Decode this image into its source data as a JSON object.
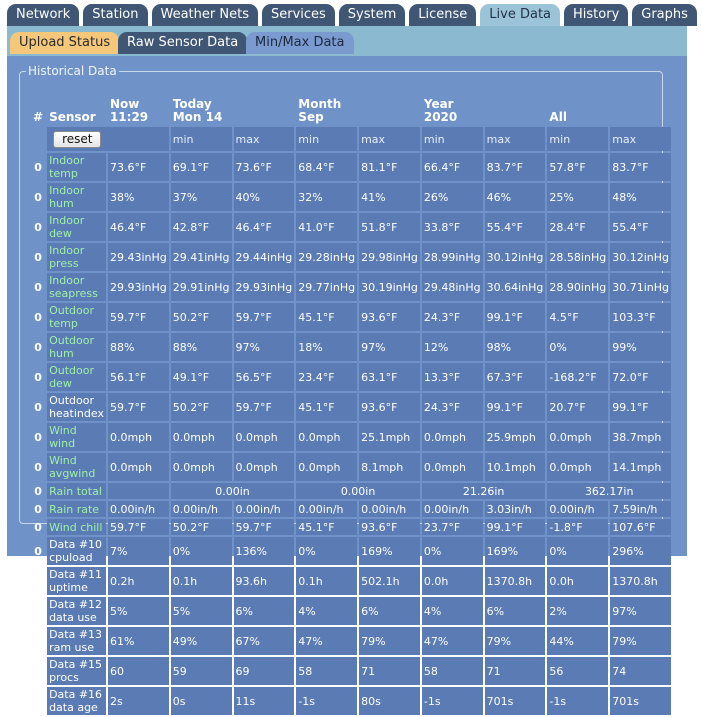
{
  "main_tabs": [
    {
      "label": "Network"
    },
    {
      "label": "Station"
    },
    {
      "label": "Weather Nets"
    },
    {
      "label": "Services"
    },
    {
      "label": "System"
    },
    {
      "label": "License"
    },
    {
      "label": "Live Data",
      "active": true
    },
    {
      "label": "History"
    },
    {
      "label": "Graphs"
    }
  ],
  "sub_tabs": {
    "upload": "Upload Status",
    "raw": "Raw Sensor Data",
    "minmax": "Min/Max Data"
  },
  "legend": "Historical Data",
  "headers": {
    "num": "#",
    "sensor": "Sensor",
    "now_a": "Now",
    "now_b": "11:29",
    "today_a": "Today",
    "today_b": "Mon 14",
    "month_a": "Month",
    "month_b": "Sep",
    "year_a": "Year",
    "year_b": "2020",
    "all": "All"
  },
  "reset_label": "reset",
  "minmax": {
    "min": "min",
    "max": "max"
  },
  "rows": [
    {
      "n": "0",
      "name": "Indoor temp",
      "now": "73.6°F",
      "tmin": "69.1°F",
      "tmax": "73.6°F",
      "mmin": "68.4°F",
      "mmax": "81.1°F",
      "ymin": "66.4°F",
      "ymax": "83.7°F",
      "amin": "57.8°F",
      "amax": "83.7°F"
    },
    {
      "n": "0",
      "name": "Indoor hum",
      "now": "38%",
      "tmin": "37%",
      "tmax": "40%",
      "mmin": "32%",
      "mmax": "41%",
      "ymin": "26%",
      "ymax": "46%",
      "amin": "25%",
      "amax": "48%"
    },
    {
      "n": "0",
      "name": "Indoor dew",
      "now": "46.4°F",
      "tmin": "42.8°F",
      "tmax": "46.4°F",
      "mmin": "41.0°F",
      "mmax": "51.8°F",
      "ymin": "33.8°F",
      "ymax": "55.4°F",
      "amin": "28.4°F",
      "amax": "55.4°F"
    },
    {
      "n": "0",
      "name": "Indoor press",
      "now": "29.43inHg",
      "tmin": "29.41inHg",
      "tmax": "29.44inHg",
      "mmin": "29.28inHg",
      "mmax": "29.98inHg",
      "ymin": "28.99inHg",
      "ymax": "30.12inHg",
      "amin": "28.58inHg",
      "amax": "30.12inHg"
    },
    {
      "n": "0",
      "name": "Indoor seapress",
      "now": "29.93inHg",
      "tmin": "29.91inHg",
      "tmax": "29.93inHg",
      "mmin": "29.77inHg",
      "mmax": "30.19inHg",
      "ymin": "29.48inHg",
      "ymax": "30.64inHg",
      "amin": "28.90inHg",
      "amax": "30.71inHg"
    },
    {
      "n": "0",
      "name": "Outdoor temp",
      "now": "59.7°F",
      "tmin": "50.2°F",
      "tmax": "59.7°F",
      "mmin": "45.1°F",
      "mmax": "93.6°F",
      "ymin": "24.3°F",
      "ymax": "99.1°F",
      "amin": "4.5°F",
      "amax": "103.3°F"
    },
    {
      "n": "0",
      "name": "Outdoor hum",
      "now": "88%",
      "tmin": "88%",
      "tmax": "97%",
      "mmin": "18%",
      "mmax": "97%",
      "ymin": "12%",
      "ymax": "98%",
      "amin": "0%",
      "amax": "99%"
    },
    {
      "n": "0",
      "name": "Outdoor dew",
      "now": "56.1°F",
      "tmin": "49.1°F",
      "tmax": "56.5°F",
      "mmin": "23.4°F",
      "mmax": "63.1°F",
      "ymin": "13.3°F",
      "ymax": "67.3°F",
      "amin": "-168.2°F",
      "amax": "72.0°F"
    },
    {
      "n": "0",
      "name": "Outdoor heatindex",
      "white": true,
      "tall": true,
      "now": "59.7°F",
      "tmin": "50.2°F",
      "tmax": "59.7°F",
      "mmin": "45.1°F",
      "mmax": "93.6°F",
      "ymin": "24.3°F",
      "ymax": "99.1°F",
      "amin": "20.7°F",
      "amax": "99.1°F"
    },
    {
      "n": "0",
      "name": "Wind wind",
      "now": "0.0mph",
      "tmin": "0.0mph",
      "tmax": "0.0mph",
      "mmin": "0.0mph",
      "mmax": "25.1mph",
      "ymin": "0.0mph",
      "ymax": "25.9mph",
      "amin": "0.0mph",
      "amax": "38.7mph"
    },
    {
      "n": "0",
      "name": "Wind avgwind",
      "now": "0.0mph",
      "tmin": "0.0mph",
      "tmax": "0.0mph",
      "mmin": "0.0mph",
      "mmax": "8.1mph",
      "ymin": "0.0mph",
      "ymax": "10.1mph",
      "amin": "0.0mph",
      "amax": "14.1mph"
    },
    {
      "n": "0",
      "name": "Rain total",
      "span": true,
      "now": "",
      "today": "0.00in",
      "month": "0.00in",
      "year": "21.26in",
      "all": "362.17in"
    },
    {
      "n": "0",
      "name": "Rain rate",
      "now": "0.00in/h",
      "tmin": "0.00in/h",
      "tmax": "0.00in/h",
      "mmin": "0.00in/h",
      "mmax": "0.00in/h",
      "ymin": "0.00in/h",
      "ymax": "3.03in/h",
      "amin": "0.00in/h",
      "amax": "7.59in/h"
    },
    {
      "n": "0",
      "name": "Wind chill",
      "now": "59.7°F",
      "tmin": "50.2°F",
      "tmax": "59.7°F",
      "mmin": "45.1°F",
      "mmax": "93.6°F",
      "ymin": "23.7°F",
      "ymax": "99.1°F",
      "amin": "-1.8°F",
      "amax": "107.6°F"
    },
    {
      "n": "0",
      "name": "Data #10 cpuload",
      "white": true,
      "tall": true,
      "now": "7%",
      "tmin": "0%",
      "tmax": "136%",
      "mmin": "0%",
      "mmax": "169%",
      "ymin": "0%",
      "ymax": "169%",
      "amin": "0%",
      "amax": "296%"
    },
    {
      "n": "0",
      "name": "Data #11 uptime",
      "white": true,
      "now": "0.2h",
      "tmin": "0.1h",
      "tmax": "93.6h",
      "mmin": "0.1h",
      "mmax": "502.1h",
      "ymin": "0.0h",
      "ymax": "1370.8h",
      "amin": "0.0h",
      "amax": "1370.8h"
    },
    {
      "n": "0",
      "name": "Data #12 data use",
      "white": true,
      "tall": true,
      "now": "5%",
      "tmin": "5%",
      "tmax": "6%",
      "mmin": "4%",
      "mmax": "6%",
      "ymin": "4%",
      "ymax": "6%",
      "amin": "2%",
      "amax": "97%"
    },
    {
      "n": "0",
      "name": "Data #13 ram use",
      "white": true,
      "tall": true,
      "now": "61%",
      "tmin": "49%",
      "tmax": "67%",
      "mmin": "47%",
      "mmax": "79%",
      "ymin": "47%",
      "ymax": "79%",
      "amin": "44%",
      "amax": "79%"
    },
    {
      "n": "0",
      "name": "Data #15 procs",
      "white": true,
      "now": "60",
      "tmin": "59",
      "tmax": "69",
      "mmin": "58",
      "mmax": "71",
      "ymin": "58",
      "ymax": "71",
      "amin": "56",
      "amax": "74"
    },
    {
      "n": "0",
      "name": "Data #16 data age",
      "white": true,
      "tall": true,
      "now": "2s",
      "tmin": "0s",
      "tmax": "11s",
      "mmin": "-1s",
      "mmax": "80s",
      "ymin": "-1s",
      "ymax": "701s",
      "amin": "-1s",
      "amax": "701s"
    }
  ]
}
